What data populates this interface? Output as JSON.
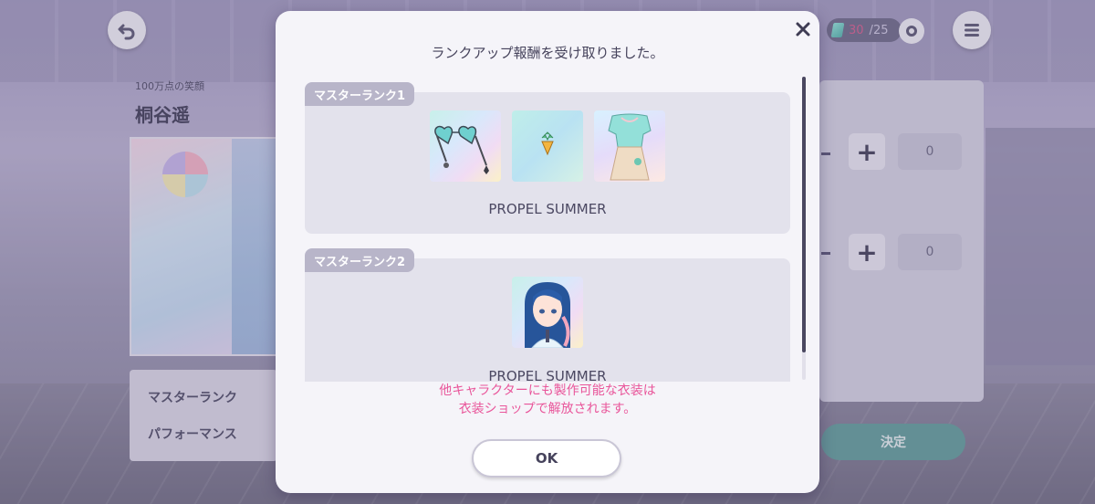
{
  "background": {
    "song_subtitle": "100万点の笑顔",
    "character_name": "桐谷遥",
    "info_rows": [
      "マスターランク",
      "パフォーマンス"
    ],
    "counts": [
      "0",
      "0"
    ],
    "decide_label": "決定",
    "stamina": {
      "current": "30",
      "max": "25"
    }
  },
  "modal": {
    "title": "ランクアップ報酬を受け取りました。",
    "rewards": [
      {
        "rank_label": "マスターランク1",
        "name": "PROPEL SUMMER",
        "items": [
          "heart-sunglasses-icon",
          "gem-charm-icon",
          "summer-outfit-icon"
        ]
      },
      {
        "rank_label": "マスターランク2",
        "name": "PROPEL SUMMER",
        "items": [
          "character-portrait-icon"
        ]
      }
    ],
    "note_line1": "他キャラクターにも製作可能な衣装は",
    "note_line2": "衣装ショップで解放されます。",
    "ok_label": "OK"
  },
  "colors": {
    "accent_pink": "#e9559a",
    "tab_gray": "#b8b5c9",
    "decide_teal": "#5f9d99"
  }
}
